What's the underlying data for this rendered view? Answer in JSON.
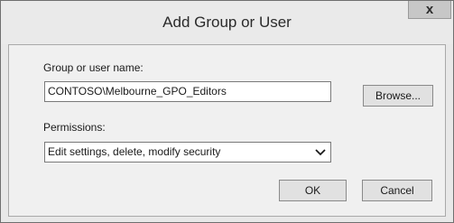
{
  "window": {
    "title": "Add Group or User",
    "close_glyph": "x"
  },
  "group_user": {
    "label": "Group or user name:",
    "value": "CONTOSO\\Melbourne_GPO_Editors",
    "browse_label": "Browse..."
  },
  "permissions": {
    "label": "Permissions:",
    "selected": "Edit settings, delete, modify security"
  },
  "buttons": {
    "ok": "OK",
    "cancel": "Cancel"
  }
}
